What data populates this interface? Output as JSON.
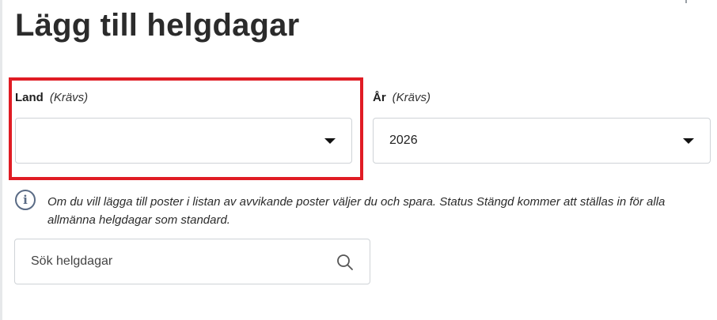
{
  "page": {
    "title": "Lägg till helgdagar"
  },
  "country_field": {
    "label": "Land",
    "required": "(Krävs)",
    "value": ""
  },
  "year_field": {
    "label": "År",
    "required": "(Krävs)",
    "value": "2026"
  },
  "info": {
    "icon": "info-icon",
    "text": "Om du vill lägga till poster i listan av avvikande poster väljer du och spara. Status Stängd kommer att ställas in för alla allmänna helgdagar som standard."
  },
  "search": {
    "placeholder": "Sök helgdagar",
    "icon": "search-icon"
  },
  "colors": {
    "highlight": "#e01c24",
    "info_icon": "#5a6b85"
  }
}
